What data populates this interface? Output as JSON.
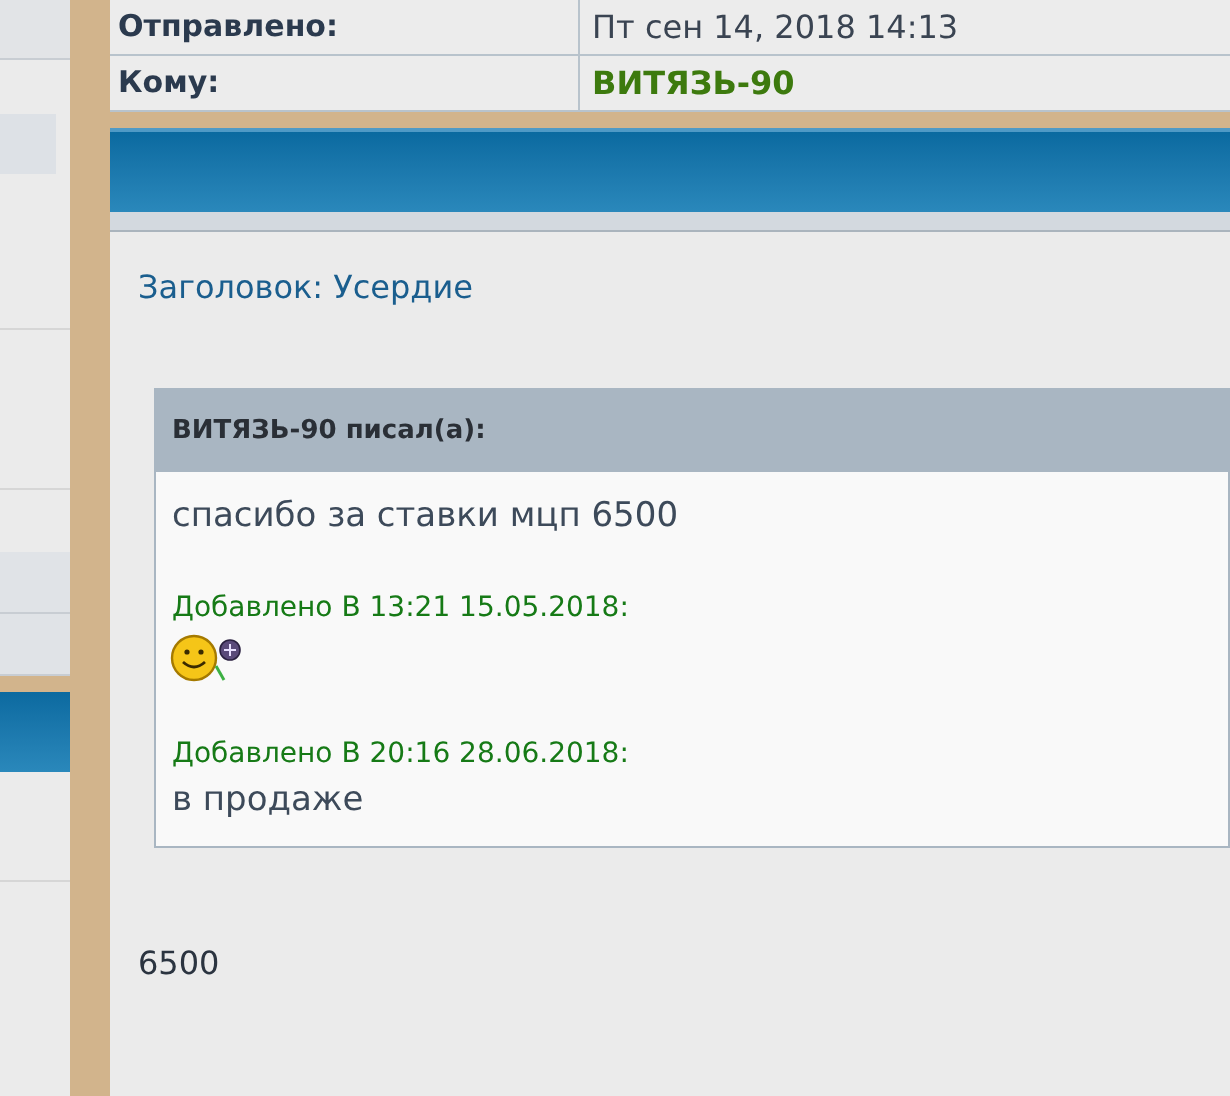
{
  "header_rows": [
    {
      "label": "Отправлено:",
      "value": "Пт сен 14, 2018 14:13",
      "kind": "text"
    },
    {
      "label": "Кому:",
      "value": "ВИТЯЗЬ-90",
      "kind": "user"
    }
  ],
  "subject": "Заголовок: Усердие",
  "quote": {
    "author": "ВИТЯЗЬ-90 писал(а):",
    "blocks": [
      {
        "kind": "text",
        "text": "спасибо за ставки мцп 6500"
      },
      {
        "kind": "added",
        "text": "Добавлено В 13:21 15.05.2018:"
      },
      {
        "kind": "smiley"
      },
      {
        "kind": "added",
        "text": "Добавлено В 20:16 28.06.2018:"
      },
      {
        "kind": "text",
        "text": "в продаже"
      }
    ]
  },
  "reply": "6500"
}
